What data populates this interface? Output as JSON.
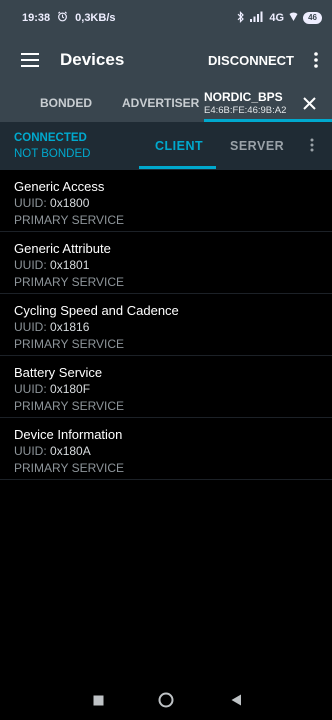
{
  "status_bar": {
    "time": "19:38",
    "net_speed": "0,3KB/s",
    "network_type": "4G",
    "battery": "46"
  },
  "app_bar": {
    "title": "Devices",
    "disconnect_label": "DISCONNECT"
  },
  "tabs": {
    "bonded": "BONDED",
    "advertiser": "ADVERTISER",
    "device_name": "NORDIC_BPS",
    "device_address": "E4:6B:FE:46:9B:A2"
  },
  "connection": {
    "state": "CONNECTED",
    "bond_state": "NOT BONDED"
  },
  "subtabs": {
    "client": "CLIENT",
    "server": "SERVER"
  },
  "uuid_label": "UUID:",
  "services": [
    {
      "name": "Generic Access",
      "uuid": "0x1800",
      "type": "PRIMARY SERVICE"
    },
    {
      "name": "Generic Attribute",
      "uuid": "0x1801",
      "type": "PRIMARY SERVICE"
    },
    {
      "name": "Cycling Speed and Cadence",
      "uuid": "0x1816",
      "type": "PRIMARY SERVICE"
    },
    {
      "name": "Battery Service",
      "uuid": "0x180F",
      "type": "PRIMARY SERVICE"
    },
    {
      "name": "Device Information",
      "uuid": "0x180A",
      "type": "PRIMARY SERVICE"
    }
  ],
  "colors": {
    "accent": "#00a9ce",
    "toolbar": "#39454e",
    "subbar": "#1f2b34"
  }
}
